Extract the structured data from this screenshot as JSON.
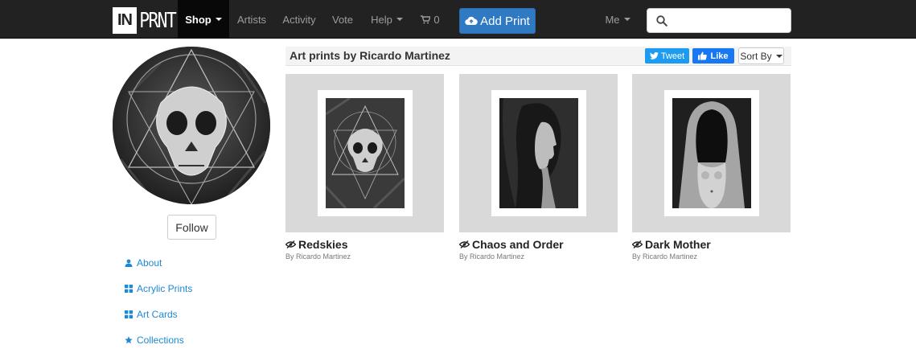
{
  "navbar": {
    "logo_in": "IN",
    "logo_prnt": "PRNT",
    "items": [
      {
        "label": "Shop",
        "has_caret": true
      },
      {
        "label": "Artists"
      },
      {
        "label": "Activity"
      },
      {
        "label": "Vote"
      },
      {
        "label": "Help",
        "has_caret": true
      },
      {
        "label": "0",
        "icon": "cart-icon"
      }
    ],
    "add_print_label": "Add Print",
    "me_label": "Me",
    "search_placeholder": ""
  },
  "sidebar": {
    "follow_label": "Follow",
    "links": [
      {
        "label": "About",
        "icon": "user-icon"
      },
      {
        "label": "Acrylic Prints",
        "icon": "grid-icon"
      },
      {
        "label": "Art Cards",
        "icon": "grid-icon"
      },
      {
        "label": "Collections",
        "icon": "star-icon"
      }
    ]
  },
  "header": {
    "title": "Art prints by Ricardo Martinez",
    "tweet_label": "Tweet",
    "like_label": "Like",
    "sort_label": "Sort By"
  },
  "products": [
    {
      "title": "Redskies",
      "by": "By Ricardo Martinez",
      "art": "skull-triangles"
    },
    {
      "title": "Chaos and Order",
      "by": "By Ricardo Martinez",
      "art": "woman-profile"
    },
    {
      "title": "Dark Mother",
      "by": "By Ricardo Martinez",
      "art": "hooded-figure"
    }
  ],
  "colors": {
    "navbar_bg": "#222222",
    "accent_blue": "#2f7ac2",
    "link_blue": "#1e88d6",
    "tweet_blue": "#1d9bf0",
    "like_blue": "#1877f2"
  }
}
